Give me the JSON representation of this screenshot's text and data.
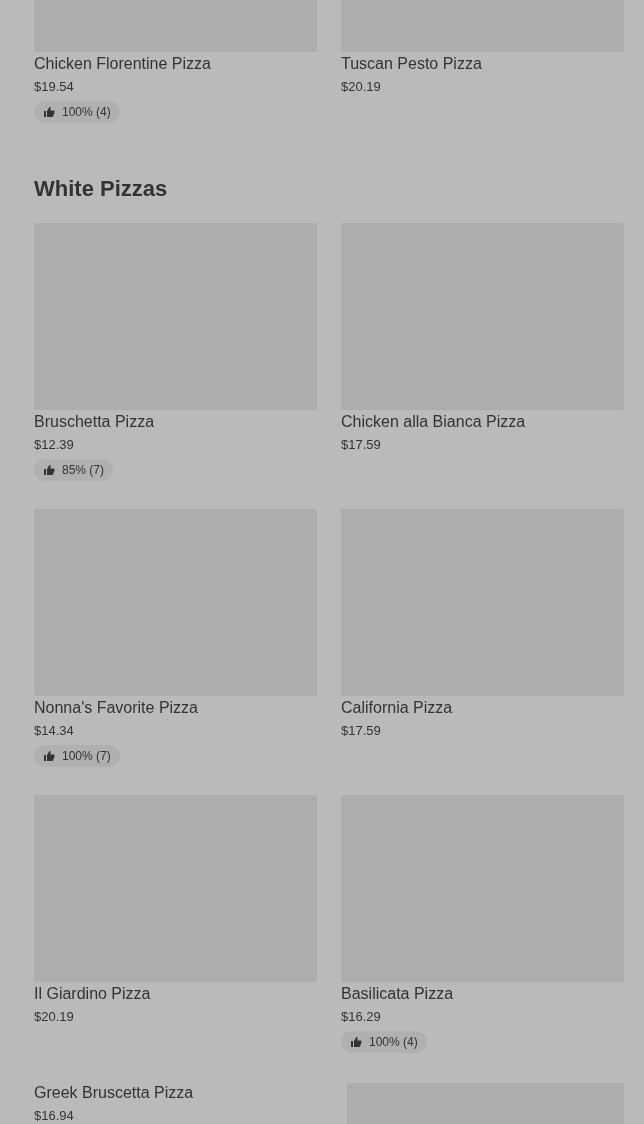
{
  "sections": [
    {
      "items": [
        {
          "kind": "card",
          "name": "Chicken Florentine Pizza",
          "price": "$19.54",
          "rating": "100% (4)"
        },
        {
          "kind": "card",
          "name": "Tuscan Pesto Pizza",
          "price": "$20.19"
        }
      ]
    },
    {
      "title": "White Pizzas",
      "items": [
        {
          "kind": "card",
          "name": "Bruschetta Pizza",
          "price": "$12.39",
          "rating": "85% (7)"
        },
        {
          "kind": "card",
          "name": "Chicken alla Bianca Pizza",
          "price": "$17.59"
        },
        {
          "kind": "card",
          "name": "Nonna's Favorite Pizza",
          "price": "$14.34",
          "rating": "100% (7)"
        },
        {
          "kind": "card",
          "name": "California Pizza",
          "price": "$17.59"
        },
        {
          "kind": "card",
          "name": "Il Giardino Pizza",
          "price": "$20.19"
        },
        {
          "kind": "card",
          "name": "Basilicata Pizza",
          "price": "$16.29",
          "rating": "100% (4)"
        },
        {
          "kind": "text_only",
          "name": "Greek Bruscetta Pizza",
          "price": "$16.94"
        },
        {
          "kind": "image_only"
        }
      ]
    }
  ]
}
